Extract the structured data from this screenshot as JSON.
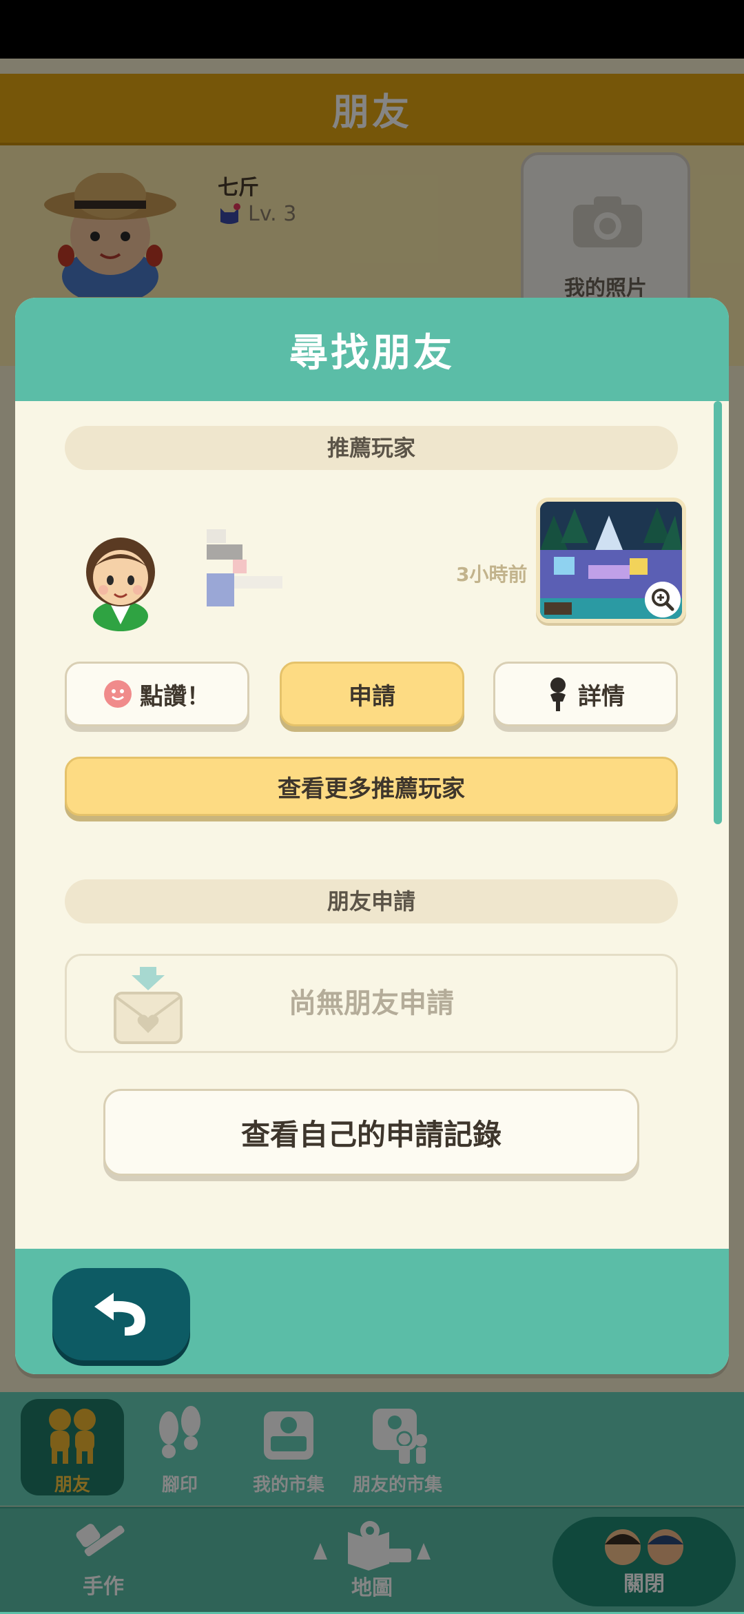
{
  "background": {
    "header_title": "朋友",
    "profile": {
      "name": "七斤",
      "level": "Lv. 3",
      "photo_label": "我的照片"
    }
  },
  "modal": {
    "title": "尋找朋友",
    "recommended_section": "推薦玩家",
    "player": {
      "time_ago": "3小時前"
    },
    "buttons": {
      "like": "點讚！",
      "apply": "申請",
      "details": "詳情",
      "more_recommended": "查看更多推薦玩家"
    },
    "friend_request_section": "朋友申請",
    "no_requests": "尚無朋友申請",
    "view_my_requests": "查看自己的申請記錄"
  },
  "bottom_nav": {
    "items": [
      {
        "label": "朋友",
        "icon": "friends-icon",
        "active": true
      },
      {
        "label": "腳印",
        "icon": "footprints-icon"
      },
      {
        "label": "我的市集",
        "icon": "my-market-icon"
      },
      {
        "label": "朋友的市集",
        "icon": "friends-market-icon"
      }
    ],
    "craft": "手作",
    "map": "地圖",
    "close": "關閉"
  },
  "colors": {
    "teal": "#5bbda7",
    "yellow": "#fddb83",
    "cream": "#f9f6e5",
    "orange": "#e3a512"
  }
}
